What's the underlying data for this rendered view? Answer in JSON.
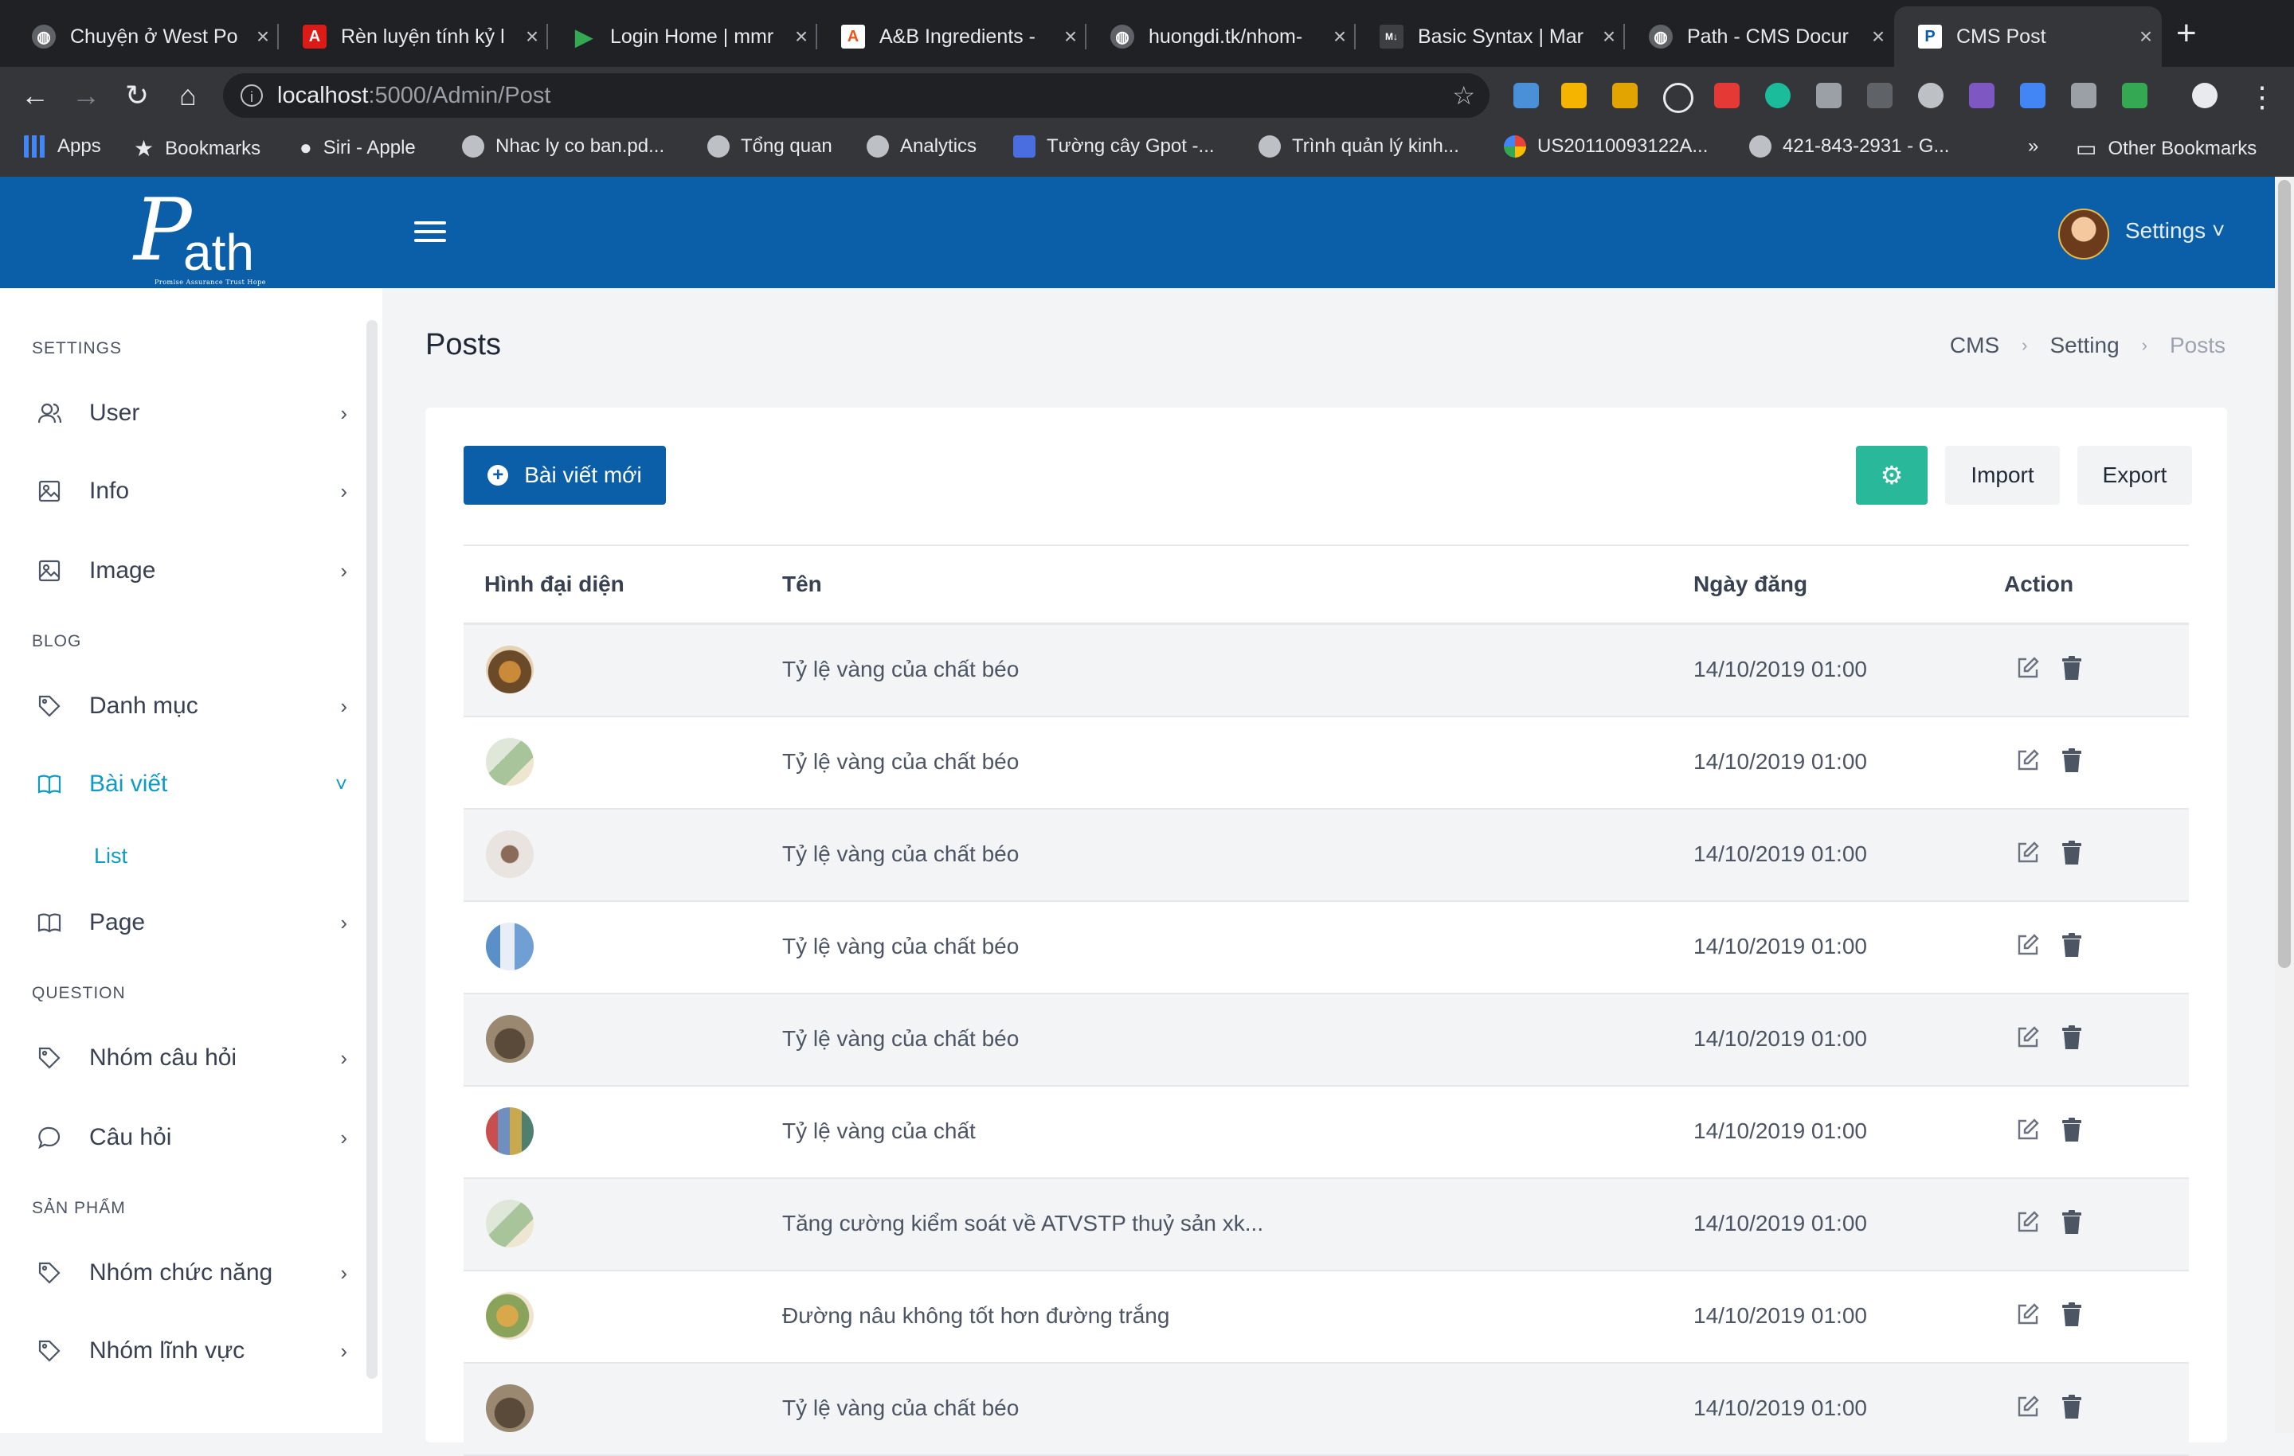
{
  "browser": {
    "tabs": [
      {
        "title": "Chuyện ở West Po",
        "icon": "globe-icon"
      },
      {
        "title": "Rèn luyện tính kỷ l",
        "icon": "angular-icon"
      },
      {
        "title": "Login Home | mmr",
        "icon": "play-icon"
      },
      {
        "title": "A&B Ingredients -",
        "icon": "ab-icon"
      },
      {
        "title": "huongdi.tk/nhom-",
        "icon": "globe-icon"
      },
      {
        "title": "Basic Syntax | Mar",
        "icon": "markdown-icon"
      },
      {
        "title": "Path - CMS Docur",
        "icon": "globe-icon"
      },
      {
        "title": "CMS Post",
        "icon": "path-icon"
      }
    ],
    "url_host": "localhost",
    "url_rest": ":5000/Admin/Post",
    "bookmarks": [
      {
        "label": "Apps"
      },
      {
        "label": "Bookmarks"
      },
      {
        "label": "Siri - Apple"
      },
      {
        "label": "Nhac ly co ban.pd..."
      },
      {
        "label": "Tổng quan"
      },
      {
        "label": "Analytics"
      },
      {
        "label": "Tường cây Gpot -..."
      },
      {
        "label": "Trình quản lý kinh..."
      },
      {
        "label": "US20110093122A..."
      },
      {
        "label": "421-843-2931 - G..."
      },
      {
        "label": "»"
      },
      {
        "label": "Other Bookmarks"
      }
    ]
  },
  "header": {
    "logo_big": "P",
    "logo_rest": "ath",
    "logo_tagline": "Promise Assurance Trust Hope",
    "settings_label": "Settings ˅"
  },
  "sidebar": {
    "sections": [
      {
        "label": "SETTINGS"
      },
      {
        "label": "BLOG"
      },
      {
        "label": "QUESTION"
      },
      {
        "label": "SẢN PHẨM"
      }
    ],
    "items": [
      {
        "label": "User",
        "icon": "user-icon"
      },
      {
        "label": "Info",
        "icon": "image-icon"
      },
      {
        "label": "Image",
        "icon": "image-icon"
      },
      {
        "label": "Danh mục",
        "icon": "tag-icon"
      },
      {
        "label": "Bài viết",
        "icon": "book-icon",
        "active": true
      },
      {
        "label": "Page",
        "icon": "book-icon"
      },
      {
        "label": "Nhóm câu hỏi",
        "icon": "tag-icon"
      },
      {
        "label": "Câu hỏi",
        "icon": "chat-icon"
      },
      {
        "label": "Nhóm chức năng",
        "icon": "tag-icon"
      },
      {
        "label": "Nhóm lĩnh vực",
        "icon": "tag-icon"
      }
    ],
    "sub_list_label": "List"
  },
  "page": {
    "title": "Posts",
    "breadcrumb": [
      "CMS",
      "Setting",
      "Posts"
    ]
  },
  "toolbar": {
    "new_post_label": "Bài viết mới",
    "import_label": "Import",
    "export_label": "Export"
  },
  "table": {
    "headers": [
      "Hình đại diện",
      "Tên",
      "Ngày đăng",
      "Action"
    ],
    "rows": [
      {
        "name": "Tỷ lệ vàng của chất béo",
        "date": "14/10/2019 01:00"
      },
      {
        "name": "Tỷ lệ vàng của chất béo",
        "date": "14/10/2019 01:00"
      },
      {
        "name": "Tỷ lệ vàng của chất béo",
        "date": "14/10/2019 01:00"
      },
      {
        "name": "Tỷ lệ vàng của chất béo",
        "date": "14/10/2019 01:00"
      },
      {
        "name": "Tỷ lệ vàng của chất béo",
        "date": "14/10/2019 01:00"
      },
      {
        "name": "Tỷ lệ vàng của chất",
        "date": "14/10/2019 01:00"
      },
      {
        "name": "Tăng cường kiểm soát về ATVSTP thuỷ sản xk...",
        "date": "14/10/2019 01:00"
      },
      {
        "name": "Đường nâu không tốt hơn đường trắng",
        "date": "14/10/2019 01:00"
      },
      {
        "name": "Tỷ lệ vàng của chất béo",
        "date": "14/10/2019 01:00"
      }
    ]
  },
  "colors": {
    "brand": "#0b5ea8",
    "accent": "#0e9bc4",
    "gear_button": "#2ab89a"
  }
}
